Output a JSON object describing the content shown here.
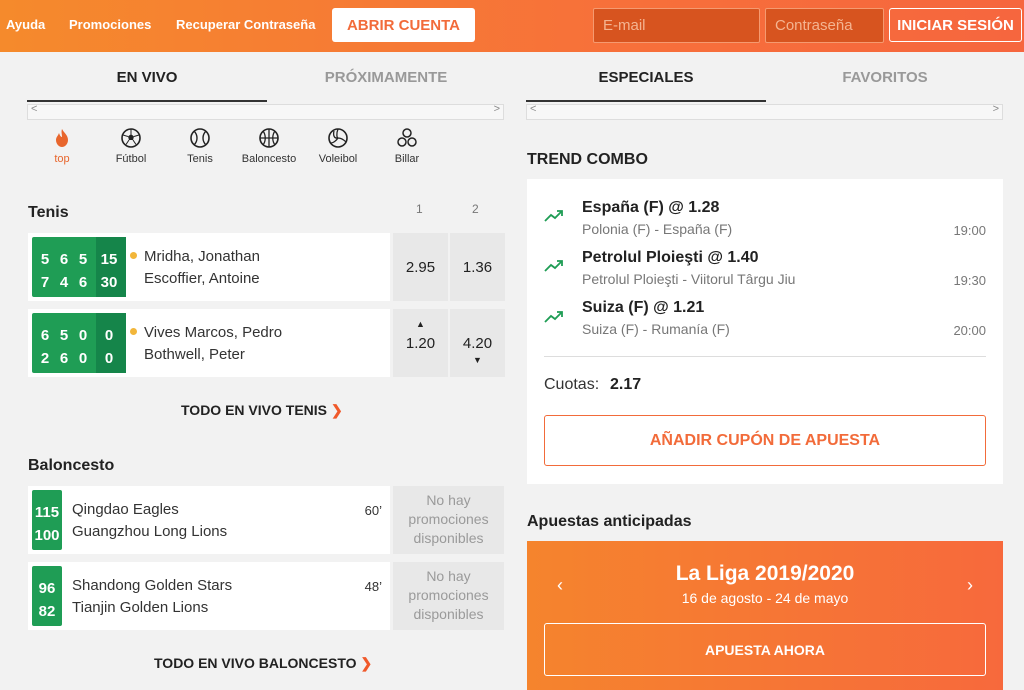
{
  "header": {
    "links": [
      "Ayuda",
      "Promociones",
      "Recuperar Contraseña"
    ],
    "open_account": "ABRIR CUENTA",
    "email_placeholder": "E-mail",
    "password_placeholder": "Contraseña",
    "login": "INICIAR SESIÓN"
  },
  "left_tabs": [
    "EN VIVO",
    "PRÓXIMAMENTE"
  ],
  "right_tabs": [
    "ESPECIALES",
    "FAVORITOS"
  ],
  "sports": [
    {
      "label": "top",
      "icon": "flame-icon"
    },
    {
      "label": "Fútbol",
      "icon": "soccer-ball-icon"
    },
    {
      "label": "Tenis",
      "icon": "tennis-ball-icon"
    },
    {
      "label": "Baloncesto",
      "icon": "basketball-icon"
    },
    {
      "label": "Voleibol",
      "icon": "volleyball-icon"
    },
    {
      "label": "Billar",
      "icon": "billiards-icon"
    }
  ],
  "tennis": {
    "title": "Tenis",
    "col1": "1",
    "col2": "2",
    "matches": [
      {
        "scores": [
          [
            "5",
            "6",
            "5",
            "15"
          ],
          [
            "7",
            "4",
            "6",
            "30"
          ]
        ],
        "p1": "Mridha, Jonathan",
        "p2": "Escoffier, Antoine",
        "odd1": "2.95",
        "odd2": "1.36"
      },
      {
        "scores": [
          [
            "6",
            "5",
            "0",
            "0"
          ],
          [
            "2",
            "6",
            "0",
            "0"
          ]
        ],
        "p1": "Vives Marcos, Pedro",
        "p2": "Bothwell, Peter",
        "odd1": "1.20",
        "odd2": "4.20"
      }
    ],
    "more": "TODO EN VIVO TENIS"
  },
  "basket": {
    "title": "Baloncesto",
    "matches": [
      {
        "s1": "115",
        "s2": "100",
        "t1": "Qingdao Eagles",
        "t2": "Guangzhou Long Lions",
        "minute": "60’",
        "promo": "No hay promociones disponibles"
      },
      {
        "s1": "96",
        "s2": "82",
        "t1": "Shandong Golden Stars",
        "t2": "Tianjin Golden Lions",
        "minute": "48’",
        "promo": "No hay promociones disponibles"
      }
    ],
    "more": "TODO EN VIVO BALONCESTO"
  },
  "trend": {
    "title": "TREND COMBO",
    "items": [
      {
        "sel": "España (F) @ 1.28",
        "match": "Polonia (F) - España (F)",
        "time": "19:00"
      },
      {
        "sel": "Petrolul Ploieşti @ 1.40",
        "match": "Petrolul Ploieşti - Viitorul Târgu Jiu",
        "time": "19:30"
      },
      {
        "sel": "Suiza (F) @ 1.21",
        "match": "Suiza (F) - Rumanía (F)",
        "time": "20:00"
      }
    ],
    "odds_label": "Cuotas:",
    "odds_value": "2.17",
    "add": "AÑADIR CUPÓN DE APUESTA"
  },
  "early": {
    "title": "Apuestas anticipadas",
    "league": "La Liga 2019/2020",
    "dates": "16 de agosto - 24 de mayo",
    "bet": "APUESTA AHORA"
  },
  "colors": {
    "accent": "#f26b3a",
    "live_green": "#1f9d55"
  }
}
